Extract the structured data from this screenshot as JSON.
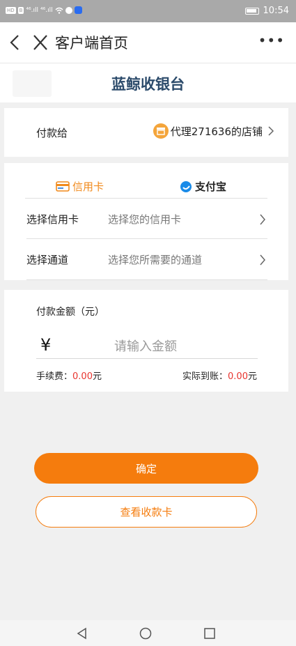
{
  "status_bar": {
    "time": "10:54",
    "left_chips": [
      "HD",
      "B"
    ],
    "signal_texts": [
      "⁴⁶.ıll",
      "⁴⁶.ıll"
    ]
  },
  "navbar": {
    "title": "客户端首页",
    "more": "•••"
  },
  "brand": {
    "title": "蓝鲸收银台"
  },
  "payee": {
    "label": "付款给",
    "store_name": "代理271636的店铺"
  },
  "payment_tabs": [
    {
      "label": "信用卡",
      "active": true,
      "icon": "credit-card-icon",
      "color": "#f18a1c"
    },
    {
      "label": "支付宝",
      "active": false,
      "icon": "alipay-icon",
      "color": "#1a8be8"
    }
  ],
  "rows": {
    "card": {
      "label": "选择信用卡",
      "placeholder": "选择您的信用卡"
    },
    "channel": {
      "label": "选择通道",
      "placeholder": "选择您所需要的通道"
    }
  },
  "amount": {
    "label": "付款金额（元）",
    "currency": "¥",
    "placeholder": "请输入金额",
    "fee_label": "手续费：",
    "fee_value": "0.00",
    "fee_unit": "元",
    "actual_label": "实际到账：",
    "actual_value": "0.00",
    "actual_unit": "元"
  },
  "buttons": {
    "confirm": "确定",
    "view_cards": "查看收款卡"
  },
  "colors": {
    "accent": "#f57c0d",
    "brand_title": "#2c4b6b",
    "money": "#e8352f"
  }
}
